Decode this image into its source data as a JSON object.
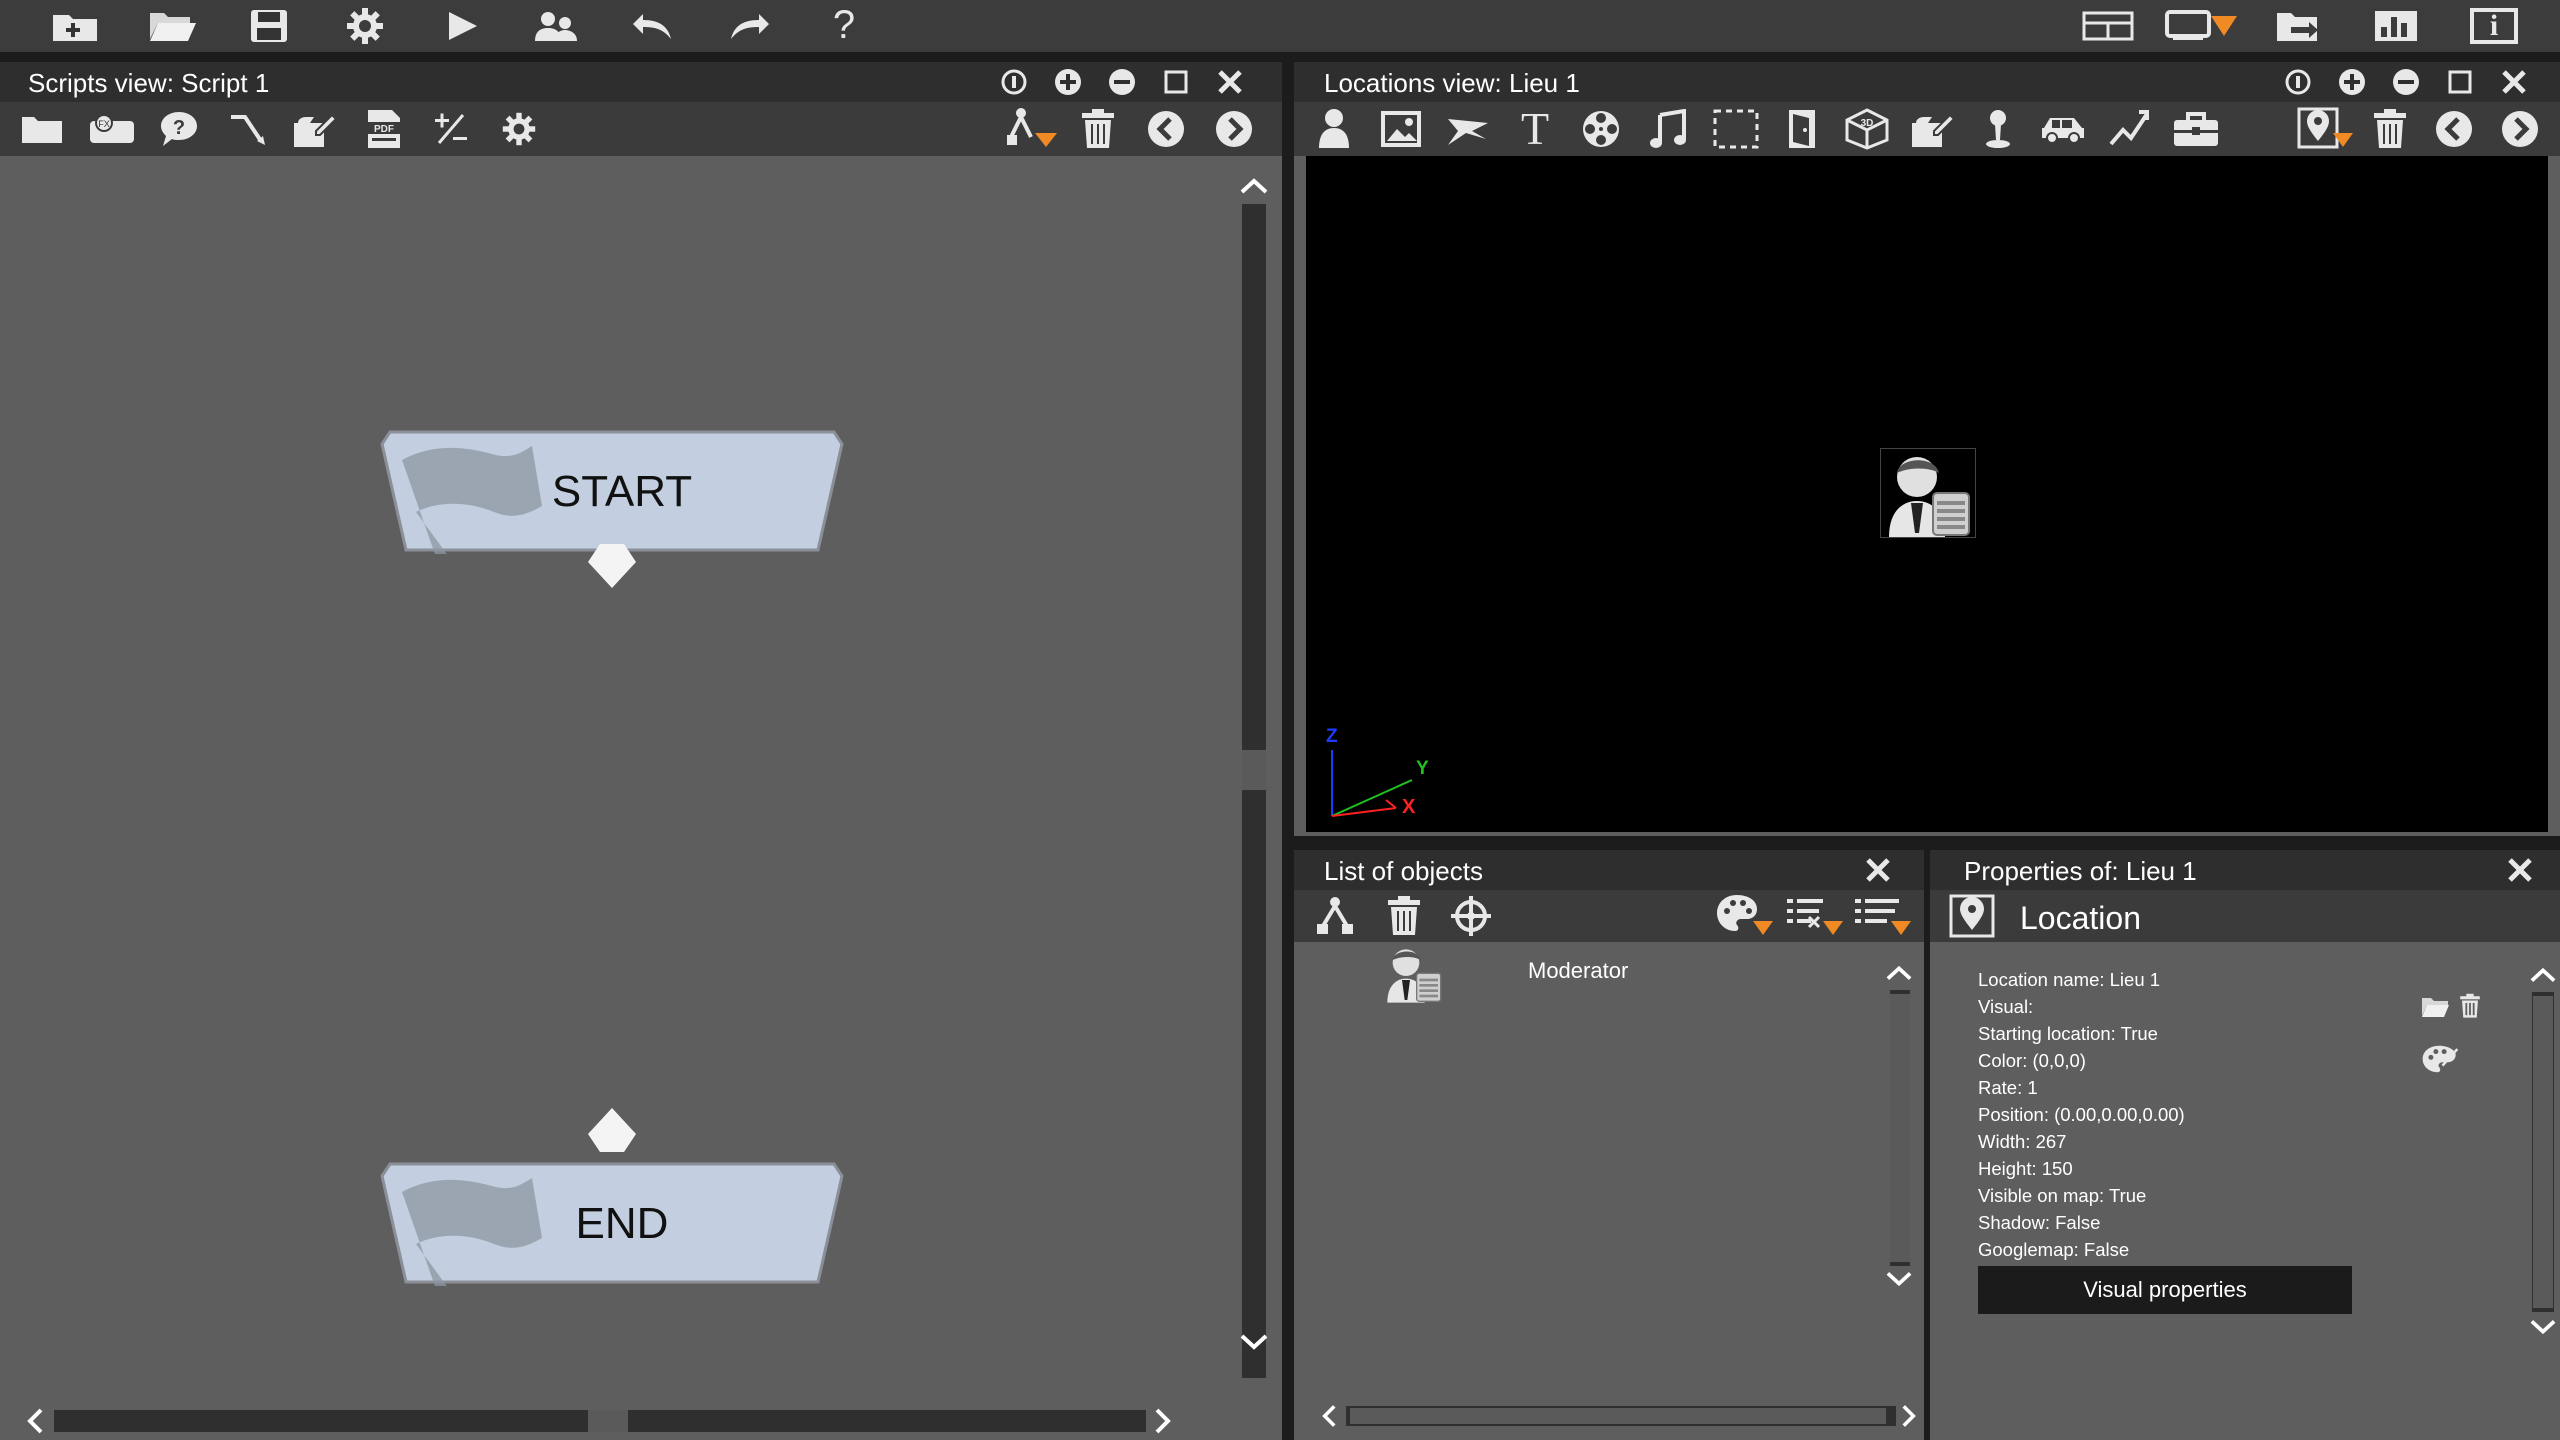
{
  "toolbar_main": {
    "left_icons": [
      "new-project-icon",
      "open-folder-icon",
      "save-icon",
      "settings-gear-icon",
      "play-icon",
      "users-icon",
      "undo-icon",
      "redo-icon",
      "help-icon"
    ],
    "help_glyph": "?",
    "right_icons": [
      "layout-split-icon",
      "display-dropdown-icon",
      "export-icon",
      "stats-chart-icon",
      "info-icon"
    ],
    "info_glyph": "i"
  },
  "scripts_view": {
    "title": "Scripts view: Script 1",
    "window_controls": [
      "pin-icon",
      "add-icon",
      "minimize-icon",
      "maximize-icon",
      "close-icon"
    ],
    "tools": [
      "folder-icon",
      "fx-icon",
      "question-bubble-icon",
      "connector-icon",
      "edit-note-icon",
      "pdf-icon",
      "plus-minus-icon",
      "gear-icon"
    ],
    "pdf_glyph": "PDF",
    "fx_glyph": "FX",
    "right_tools": [
      "tree-dropdown-icon",
      "trash-icon",
      "prev-icon",
      "next-icon"
    ],
    "nodes": {
      "start": "START",
      "end": "END"
    }
  },
  "locations_view": {
    "title": "Locations view: Lieu 1",
    "window_controls": [
      "pin-icon",
      "add-icon",
      "minimize-icon",
      "maximize-icon",
      "close-icon"
    ],
    "tools": [
      "person-icon",
      "image-icon",
      "surface-icon",
      "text-icon",
      "film-reel-icon",
      "music-icon",
      "selection-icon",
      "door-icon",
      "3d-box-icon",
      "edit-note-icon",
      "marker-pin-icon",
      "car-icon",
      "path-icon",
      "briefcase-icon"
    ],
    "text_glyph": "T",
    "box_glyph": "3D",
    "right_tools": [
      "location-pin-dropdown-icon",
      "trash-icon",
      "prev-icon",
      "next-icon"
    ],
    "axes": {
      "z": "Z",
      "y": "Y",
      "x": "X"
    },
    "colors": {
      "z": "#1a3cff",
      "y": "#21c021",
      "x": "#ff2020"
    }
  },
  "objects_list": {
    "title": "List of objects",
    "tools": [
      "tree-icon",
      "trash-icon",
      "crosshair-icon"
    ],
    "right_tools": [
      "palette-dropdown-icon",
      "filter-list-dropdown-icon",
      "list-dropdown-icon"
    ],
    "items": [
      {
        "name": "Moderator",
        "icon": "moderator-avatar-icon"
      }
    ]
  },
  "properties": {
    "title": "Properties of: Lieu 1",
    "type_label": "Location",
    "type_icon": "location-pin-icon",
    "lines": [
      "Location name: Lieu 1",
      "Visual:",
      "Starting location: True",
      "Color: (0,0,0)",
      "Rate: 1",
      "Position: (0.00,0.00,0.00)",
      "Width: 267",
      "Height: 150",
      "Visible on map: True",
      "Shadow: False",
      "Googlemap: False"
    ],
    "visual_button": "Visual properties",
    "side_icons": [
      "folder-open-icon",
      "trash-icon",
      "palette-icon"
    ]
  },
  "colors": {
    "accent_orange": "#f08a24",
    "node_fill": "#c3cfe0",
    "canvas_black": "#000000"
  }
}
